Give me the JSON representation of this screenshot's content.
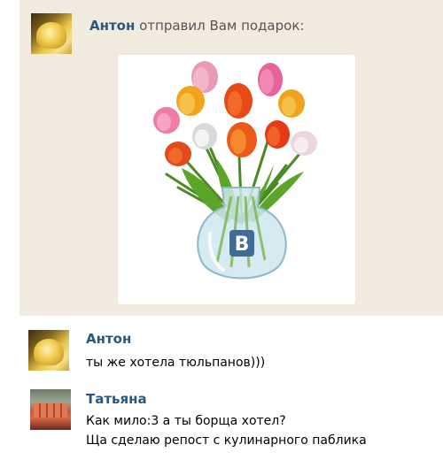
{
  "gift_notice": {
    "sender": "Антон",
    "text": "отправил Вам подарок:",
    "gift_icon": "tulip-bouquet-vase-vk-icon"
  },
  "messages": [
    {
      "author": "Антон",
      "avatar_icon": "avatar-photo",
      "lines": [
        "ты же хотела тюльпанов)))"
      ]
    },
    {
      "author": "Татьяна",
      "avatar_icon": "avatar-photo",
      "lines": [
        "Как мило:3 а ты борща хотел?",
        "Ща сделаю репост с кулинарного паблика"
      ]
    }
  ],
  "colors": {
    "name": "#2b587a",
    "gift_background": "#f1ecdf",
    "vk_logo": "#3f6b96"
  }
}
